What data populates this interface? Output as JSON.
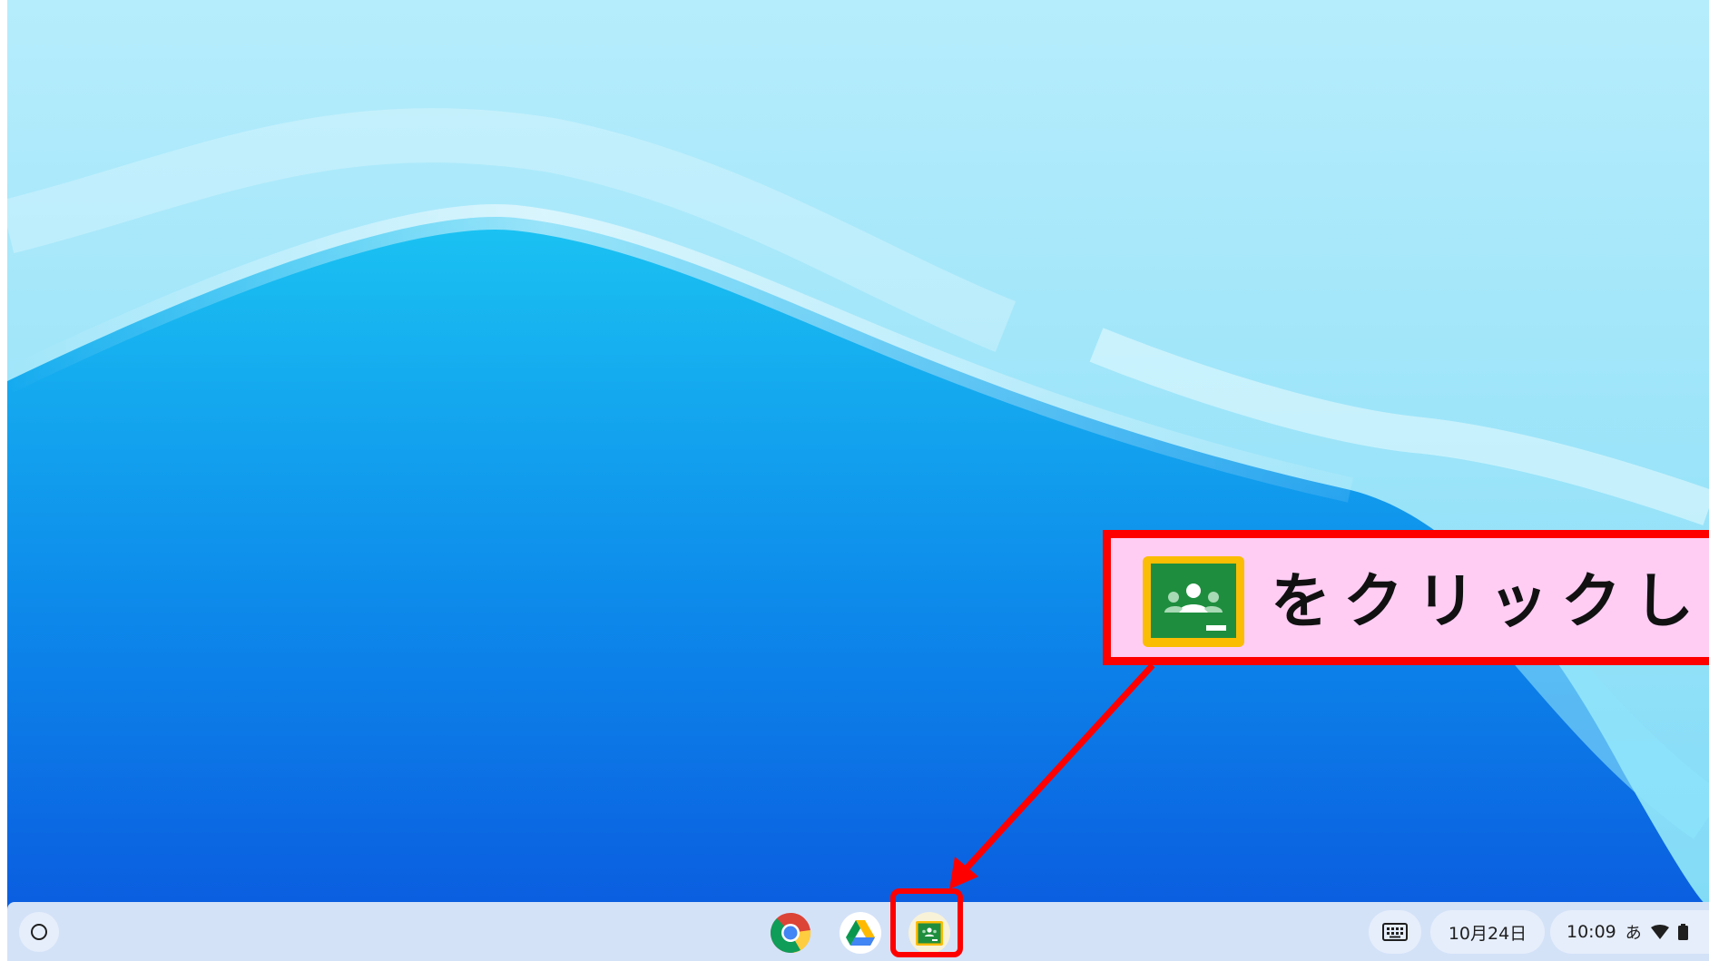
{
  "shelf": {
    "launcher_icon": "launcher-circle-icon",
    "pinned_apps": [
      {
        "name": "Google Chrome",
        "icon": "chrome-icon"
      },
      {
        "name": "Google Drive",
        "icon": "drive-icon"
      },
      {
        "name": "Google Classroom",
        "icon": "classroom-icon"
      }
    ],
    "tray": {
      "keyboard_icon": "keyboard-icon",
      "date": "10月24日",
      "time": "10:09",
      "ime": "あ",
      "wifi_icon": "wifi-icon",
      "battery_icon": "battery-icon"
    }
  },
  "callout": {
    "icon": "classroom-icon",
    "text": "をクリックしま"
  },
  "colors": {
    "annotation_red": "#ff0000",
    "callout_bg": "#ffcdf4",
    "shelf_bg": "#d4e2f8",
    "classroom_green": "#1e8e3e",
    "classroom_yellow": "#fbbc04"
  }
}
